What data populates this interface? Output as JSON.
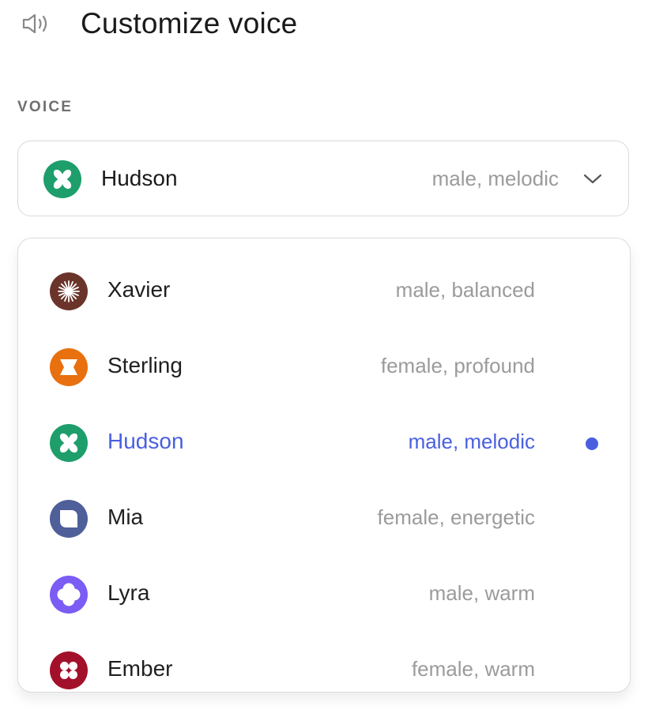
{
  "header": {
    "title": "Customize voice",
    "icon": "speaker-icon"
  },
  "section": {
    "label": "VOICE"
  },
  "select": {
    "selected_name": "Hudson",
    "selected_desc": "male, melodic",
    "icon": "clover-icon",
    "color": "#1e9e6b"
  },
  "options": [
    {
      "name": "Xavier",
      "desc": "male, balanced",
      "color": "#6b342a",
      "icon": "starburst-icon"
    },
    {
      "name": "Sterling",
      "desc": "female, profound",
      "color": "#e8700e",
      "icon": "hourglass-icon"
    },
    {
      "name": "Hudson",
      "desc": "male, melodic",
      "color": "#1e9e6b",
      "icon": "clover-icon",
      "selected": true
    },
    {
      "name": "Mia",
      "desc": "female, energetic",
      "color": "#4f5f9a",
      "icon": "leaf-icon"
    },
    {
      "name": "Lyra",
      "desc": "male, warm",
      "color": "#7b5cf5",
      "icon": "flower-icon"
    },
    {
      "name": "Ember",
      "desc": "female, warm",
      "color": "#a3102a",
      "icon": "quatrefoil-icon"
    }
  ],
  "accent": "#4a5fe0"
}
